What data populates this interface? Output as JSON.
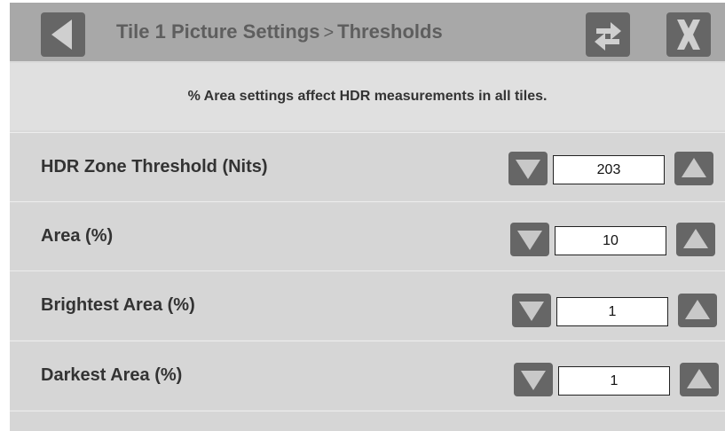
{
  "header": {
    "title": "Tile 1 Picture Settings",
    "separator": ">",
    "subtitle": "Thresholds",
    "icons": [
      "back-arrow-icon",
      "swap-arrows-icon",
      "close-x-icon"
    ]
  },
  "notice": "% Area settings affect HDR measurements in all tiles.",
  "settings": [
    {
      "label": "HDR Zone Threshold (Nits)",
      "value": "203"
    },
    {
      "label": "Area (%)",
      "value": "10"
    },
    {
      "label": "Brightest Area (%)",
      "value": "1"
    },
    {
      "label": "Darkest Area (%)",
      "value": "1"
    }
  ],
  "colors": {
    "header_bg": "#a8a8a8",
    "panel_bg": "#d6d6d6",
    "button_bg": "#666666",
    "icon_fg": "#c8c8c8"
  }
}
